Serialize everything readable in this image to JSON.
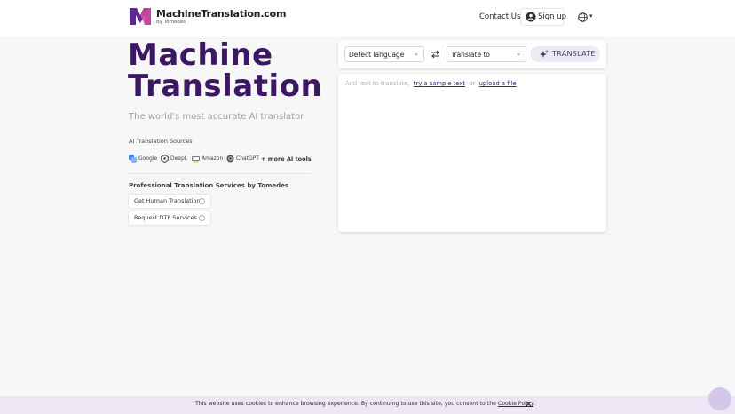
{
  "header": {
    "brand_name": "MachineTranslation.com",
    "brand_sub": "By Tomedes",
    "contact_label": "Contact Us",
    "signup_label": "Sign up",
    "lang_caret": "▾"
  },
  "hero": {
    "title_line1": "Machine",
    "title_line2": "Translation",
    "subtitle": "The world's most accurate AI translator"
  },
  "sources": {
    "title": "AI Translation Sources",
    "items": [
      {
        "label": "Google",
        "icon": "google-icon"
      },
      {
        "label": "DeepL",
        "icon": "deepl-icon"
      },
      {
        "label": "Amazon",
        "icon": "amazon-icon"
      },
      {
        "label": "ChatGPT",
        "icon": "chatgpt-icon"
      }
    ],
    "more_label": "+ more AI tools"
  },
  "pro": {
    "title": "Professional Translation Services by Tomedes",
    "buttons": [
      {
        "label": "Get Human Translation",
        "icon": "info-icon"
      },
      {
        "label": "Request DTP Services",
        "icon": "info-icon"
      }
    ]
  },
  "translator": {
    "source_select": "Detect language",
    "target_select": "Translate to",
    "translate_label": "TRANSLATE",
    "input_placeholder": "Add text to translate,",
    "sample_link": "try a sample text",
    "or_text": "or",
    "upload_link": "upload a file"
  },
  "cookie": {
    "text": "This website uses cookies to enhance browsing experience. By continuing to use this site, you consent to the",
    "link": "Cookie Policy",
    "period": "."
  },
  "colors": {
    "brand_purple": "#3c1763",
    "accent_purple": "#6b3fa0",
    "cookie_bg": "#ece6f5"
  }
}
